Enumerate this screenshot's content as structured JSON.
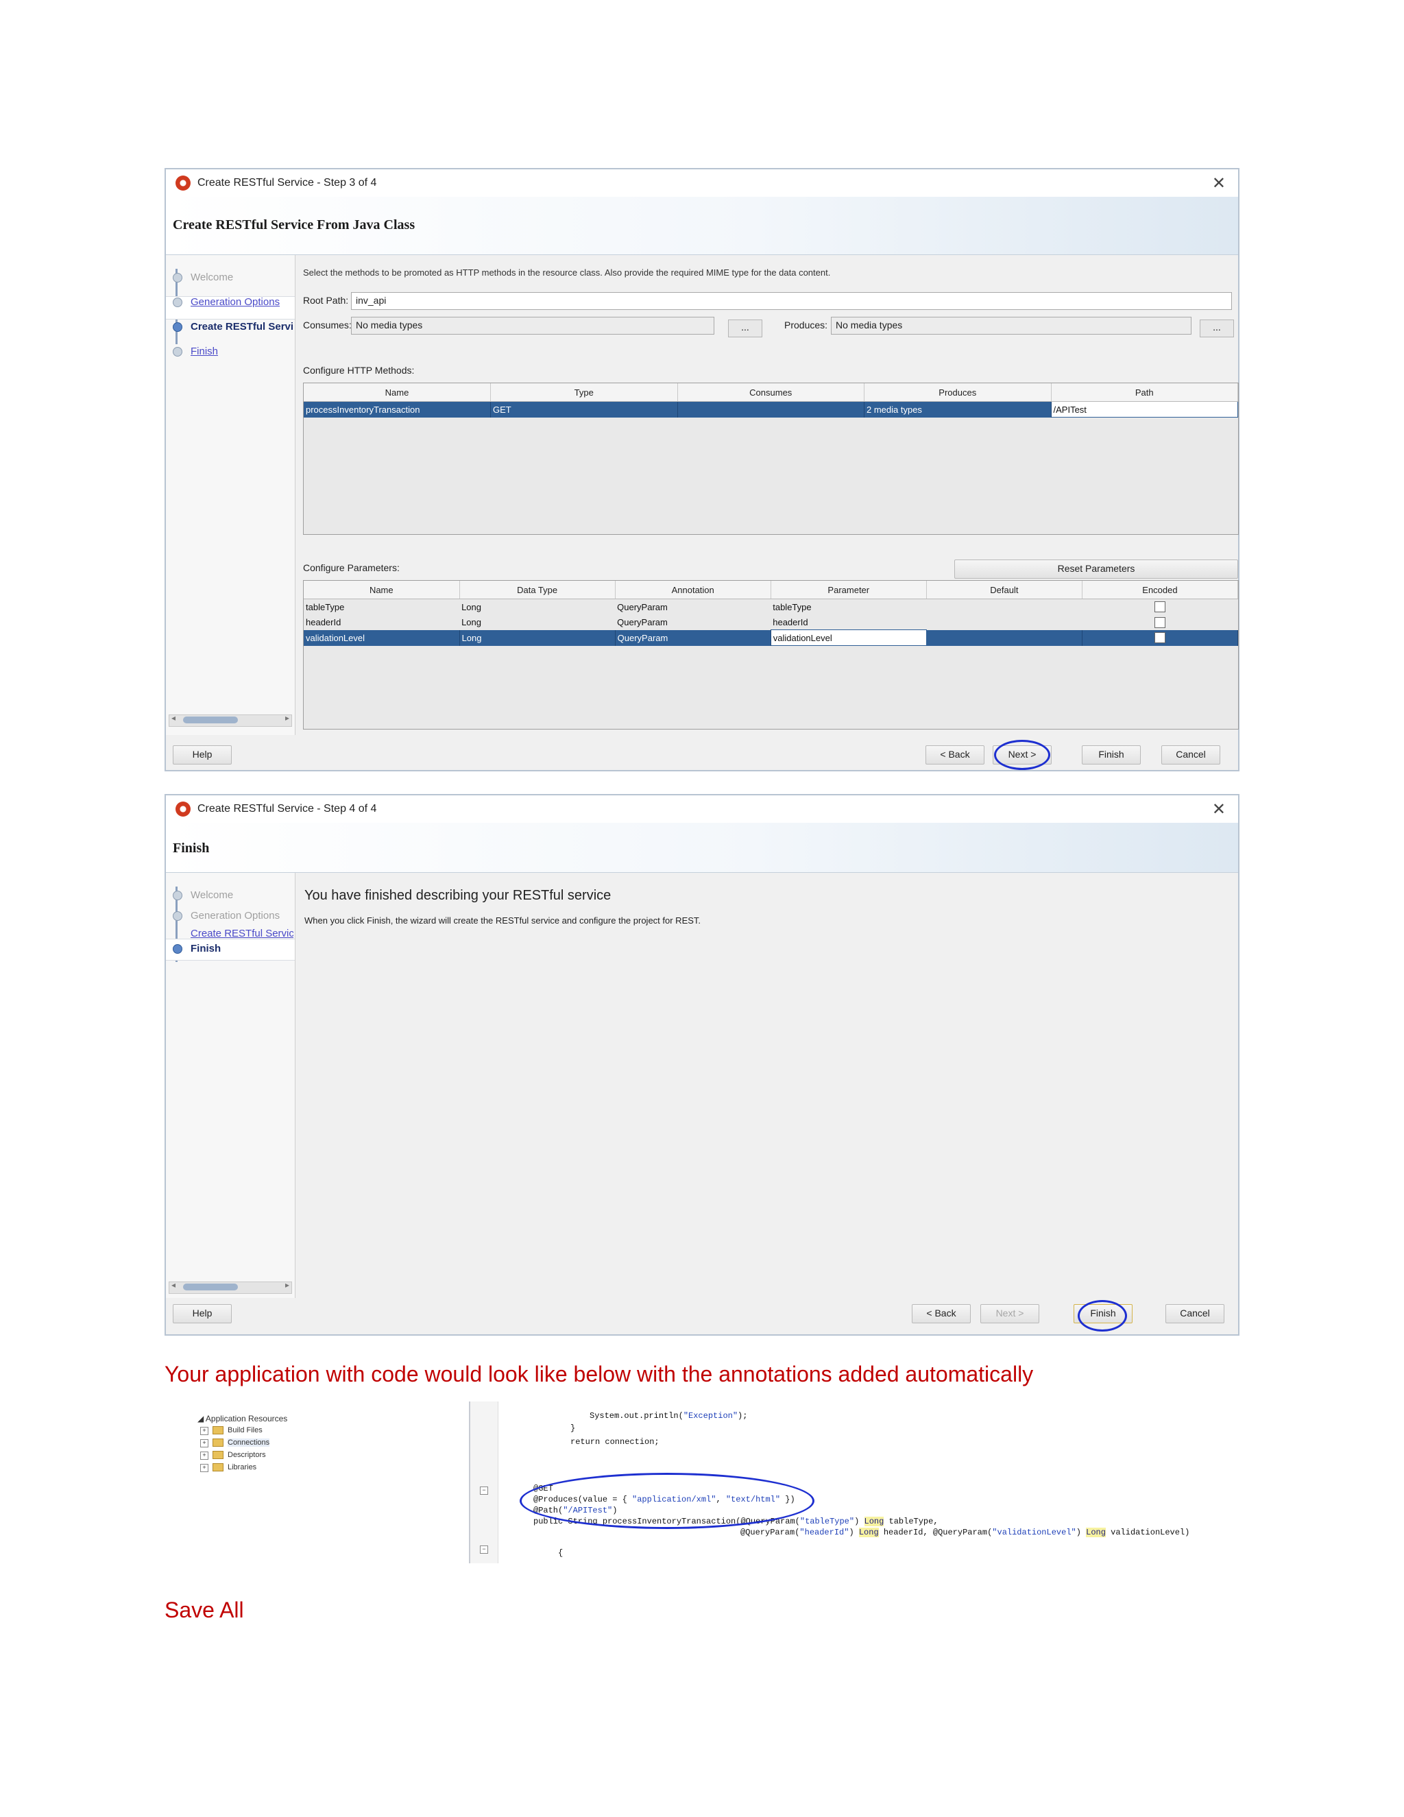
{
  "dialog1": {
    "title": "Create RESTful Service - Step 3 of 4",
    "banner": "Create RESTful Service From Java Class",
    "steps": [
      "Welcome",
      "Generation Options",
      "Create RESTful Servi",
      "Finish"
    ],
    "instruction": "Select the methods to be promoted as HTTP methods in the resource class. Also provide the required MIME type for the data content.",
    "root_path_label": "Root Path:",
    "root_path_value": "inv_api",
    "consumes_label": "Consumes:",
    "consumes_value": "No media types",
    "produces_label": "Produces:",
    "produces_value": "No media types",
    "ellipsis": "...",
    "methods_label": "Configure HTTP Methods:",
    "methods_columns": [
      "Name",
      "Type",
      "Consumes",
      "Produces",
      "Path"
    ],
    "methods_rows": [
      [
        "processInventoryTransaction",
        "GET",
        "",
        "2 media types",
        "/APITest"
      ]
    ],
    "params_label": "Configure Parameters:",
    "reset_button": "Reset Parameters",
    "params_columns": [
      "Name",
      "Data Type",
      "Annotation",
      "Parameter",
      "Default",
      "Encoded"
    ],
    "params_rows": [
      [
        "tableType",
        "Long",
        "QueryParam",
        "tableType",
        ""
      ],
      [
        "headerId",
        "Long",
        "QueryParam",
        "headerId",
        ""
      ],
      [
        "validationLevel",
        "Long",
        "QueryParam",
        "validationLevel",
        ""
      ]
    ],
    "buttons": {
      "help": "Help",
      "back": "< Back",
      "next": "Next >",
      "finish": "Finish",
      "cancel": "Cancel"
    }
  },
  "dialog2": {
    "title": "Create RESTful Service - Step 4 of 4",
    "banner": "Finish",
    "steps": [
      "Welcome",
      "Generation Options",
      "Create RESTful Service f",
      "Finish"
    ],
    "heading": "You have finished describing your RESTful service",
    "body": "When you click Finish, the wizard will create the RESTful service and configure the project for REST.",
    "buttons": {
      "help": "Help",
      "back": "< Back",
      "next": "Next >",
      "finish": "Finish",
      "cancel": "Cancel"
    }
  },
  "caption1": "Your application with code would look like below with the annotations added automatically",
  "tree": {
    "root": "Application Resources",
    "items": [
      "Build Files",
      "Connections",
      "Descriptors",
      "Libraries"
    ]
  },
  "code": {
    "l1a": "System.out.println(",
    "l1s": "\"Exception\"",
    "l1b": ");",
    "l2": "}",
    "l3": "return connection;",
    "l4": "@GET",
    "l5a": "@Produces(value = { ",
    "l5s1": "\"application/xml\"",
    "l5c": ", ",
    "l5s2": "\"text/html\"",
    "l5b": " })",
    "l6a": "@Path(",
    "l6s": "\"/APITest\"",
    "l6b": ")",
    "l7a": "public String processInventoryTransaction(@QueryParam(",
    "l7s": "\"tableType\"",
    "l7b": ") ",
    "l7k": "Long",
    "l7c": " tableType,",
    "l8a": "@QueryParam(",
    "l8s1": "\"headerId\"",
    "l8b": ") ",
    "l8k1": "Long",
    "l8c": " headerId, @QueryParam(",
    "l8s2": "\"validationLevel\"",
    "l8d": ") ",
    "l8k2": "Long",
    "l8e": " validationLevel)",
    "l9": "{"
  },
  "caption2": "Save All"
}
